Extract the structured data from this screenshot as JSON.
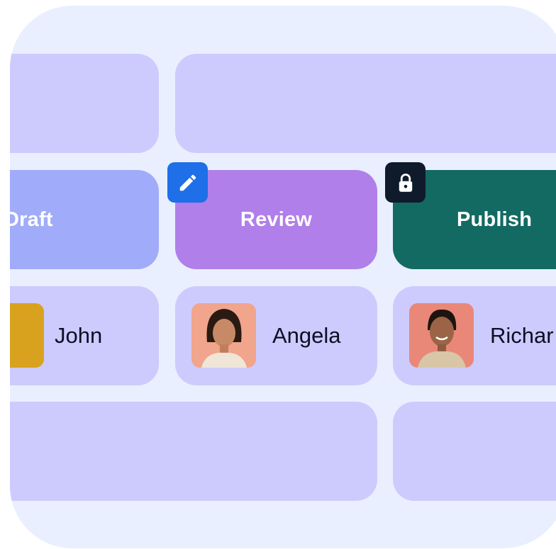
{
  "stages": {
    "draft": "Draft",
    "review": "Review",
    "publish": "Publish"
  },
  "badges": {
    "review_icon": "pencil-icon",
    "publish_icon": "lock-icon"
  },
  "people": [
    {
      "name": "John"
    },
    {
      "name": "Angela"
    },
    {
      "name": "Richar"
    }
  ],
  "colors": {
    "background": "#e9efff",
    "card": "#cdcbfd",
    "draft": "#a0acf9",
    "review": "#b07fe9",
    "publish": "#136a63",
    "edit_badge": "#1e6fe8",
    "lock_badge": "#0f1b2b",
    "text_dark": "#0c0f24"
  }
}
